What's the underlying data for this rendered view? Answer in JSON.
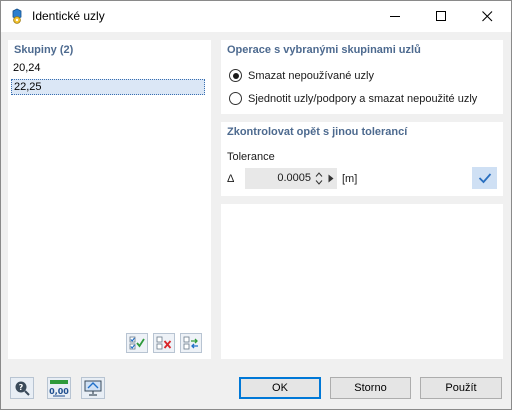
{
  "window": {
    "title": "Identické uzly"
  },
  "groups": {
    "header": "Skupiny (2)",
    "items": [
      "20,24",
      "22,25"
    ],
    "selected_index": 1
  },
  "operations": {
    "header": "Operace s vybranými skupinami uzlů",
    "options": [
      {
        "label": "Smazat nepoužívané uzly",
        "checked": true
      },
      {
        "label": "Sjednotit uzly/podpory a smazat nepoužité uzly",
        "checked": false
      }
    ]
  },
  "recheck": {
    "header": "Zkontrolovat opět s jinou tolerancí",
    "tolerance_label": "Tolerance",
    "delta_symbol": "Δ",
    "tolerance_value": "0.0005",
    "unit": "[m]"
  },
  "buttons": {
    "ok": "OK",
    "cancel": "Storno",
    "apply": "Použít"
  },
  "footer": {
    "units_icon_text": "0,00"
  },
  "colors": {
    "header_text": "#4d6a8f",
    "accent": "#0078d7",
    "check_button_bg": "#cfe0f4"
  }
}
